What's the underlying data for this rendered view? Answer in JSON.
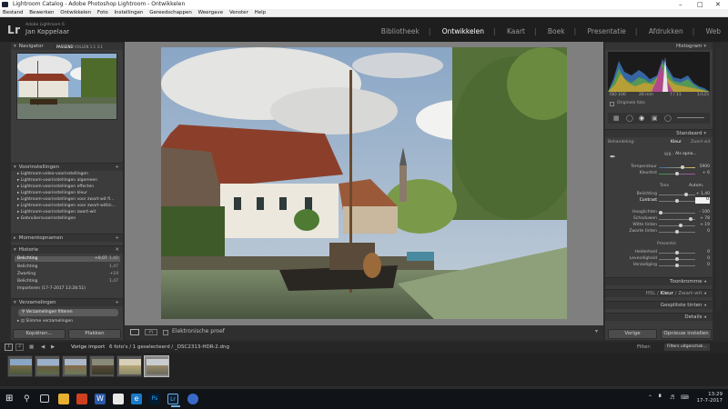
{
  "window": {
    "title": "Lightroom Catalog - Adobe Photoshop Lightroom - Ontwikkelen"
  },
  "menubar": {
    "items": [
      "Bestand",
      "Bewerken",
      "Ontwikkelen",
      "Foto",
      "Instellingen",
      "Gereedschappen",
      "Weergave",
      "Venster",
      "Help"
    ]
  },
  "identity": {
    "logo": "Lr",
    "sub": "Adobe Lightroom 6",
    "user": "Jan Koppelaar"
  },
  "modules": [
    "Bibliotheek",
    "Ontwikkelen",
    "Kaart",
    "Boek",
    "Presentatie",
    "Afdrukken",
    "Web"
  ],
  "left": {
    "navigator": {
      "title": "Navigator",
      "modes": [
        "PASSEND",
        "VULLEN",
        "1:1",
        "3:1"
      ]
    },
    "presets": {
      "title": "Voorinstellingen",
      "items": [
        "Lightroom-video-voorinstellingen",
        "Lightroom-voorinstellingen algemeen",
        "Lightroom-voorinstellingen effecten",
        "Lightroom-voorinstellingen kleur",
        "Lightroom-voorinstellingen voor zwart-wit fi...",
        "Lightroom-voorinstellingen voor zwart-wittin...",
        "Lightroom-voorinstellingen zwart-wit",
        "Gebruikersvoorinstellingen"
      ]
    },
    "snapshots": {
      "title": "Momentopnamen"
    },
    "history": {
      "title": "Historie",
      "items": [
        {
          "name": "Belichting",
          "v1": "+0,07",
          "v2": "1,40"
        },
        {
          "name": "Belichting",
          "v1": "",
          "v2": "1,47"
        },
        {
          "name": "Zwarting",
          "v1": "",
          "v2": "+19"
        },
        {
          "name": "Belichting",
          "v1": "",
          "v2": "1,47"
        },
        {
          "name": "Importeren (17-7-2017 13:28:51)",
          "v1": "",
          "v2": ""
        }
      ]
    },
    "collections": {
      "title": "Verzamelingen",
      "filter": "Verzamelingen filteren",
      "item": "Slimme verzamelingen"
    },
    "copy_label": "Kopiëren...",
    "paste_label": "Plakken"
  },
  "right": {
    "histogram": {
      "title": "Histogram",
      "iso": "ISO 100",
      "focal": "26 mm",
      "aperture": "f / 11",
      "shutter": "1/125",
      "original": "Originele foto"
    },
    "basic": {
      "title": "Standaard",
      "treatment_label": "Behandeling:",
      "treat_color": "Kleur",
      "treat_bw": "Zwart-wit",
      "wb_label": "WB :",
      "wb_value": "Als opno...",
      "temp_label": "Temperatuur",
      "temp_value": "5900",
      "tint_label": "Kleurtint",
      "tint_value": "+ 6",
      "tone_label": "Toon",
      "auto_label": "Autom.",
      "exposure_label": "Belichting",
      "exposure_value": "+ 1,40",
      "contrast_label": "Contrast",
      "contrast_value": "0",
      "highlights_label": "Hooglichten",
      "highlights_value": "- 100",
      "shadows_label": "Schaduwen",
      "shadows_value": "+ 78",
      "whites_label": "Witte tinten",
      "whites_value": "+ 19",
      "blacks_label": "Zwarte tinten",
      "blacks_value": "0",
      "presence_label": "Presentie",
      "clarity_label": "Helderheid",
      "clarity_value": "0",
      "vibrance_label": "Levendigheid",
      "vibrance_value": "0",
      "saturation_label": "Verzadiging",
      "saturation_value": "0"
    },
    "tone_curve": "Toonkromme",
    "hsl": {
      "a": "HSL /",
      "b": "Kleur",
      "c": "/ Zwart-wit"
    },
    "split_toning": "Gesplitste tinten",
    "detail": "Details",
    "prev_label": "Vorige",
    "reset_label": "Opnieuw instellen"
  },
  "toolbar": {
    "proof": "Elektronische proef"
  },
  "filmbar": {
    "pages": [
      "1",
      "2"
    ],
    "source": "Vorige import",
    "info": "6 foto's / 1 geselecteerd / _DSC2313-HDR-2.dng",
    "filter_label": "Filter:",
    "filter_value": "Filters uitgeschak..."
  },
  "taskbar": {
    "time": "13:29",
    "date": "17-7-2017"
  }
}
